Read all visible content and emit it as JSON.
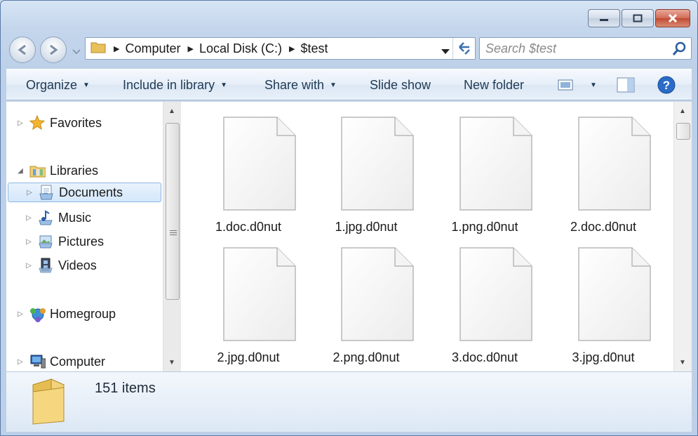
{
  "window": {
    "caption_buttons": [
      "minimize",
      "maximize",
      "close"
    ]
  },
  "address": {
    "crumbs": [
      "Computer",
      "Local Disk (C:)",
      "$test"
    ]
  },
  "search": {
    "placeholder": "Search $test"
  },
  "toolbar": {
    "organize": "Organize",
    "include_in_library": "Include in library",
    "share_with": "Share with",
    "slide_show": "Slide show",
    "new_folder": "New folder"
  },
  "nav": {
    "favorites": "Favorites",
    "libraries": "Libraries",
    "documents": "Documents",
    "music": "Music",
    "pictures": "Pictures",
    "videos": "Videos",
    "homegroup": "Homegroup",
    "computer": "Computer"
  },
  "files": [
    "1.doc.d0nut",
    "1.jpg.d0nut",
    "1.png.d0nut",
    "2.doc.d0nut",
    "2.jpg.d0nut",
    "2.png.d0nut",
    "3.doc.d0nut",
    "3.jpg.d0nut"
  ],
  "status": {
    "item_count": "151 items"
  },
  "colors": {
    "selection": "#d4e7fb",
    "accent": "#1e3954",
    "close": "#c24b33"
  }
}
